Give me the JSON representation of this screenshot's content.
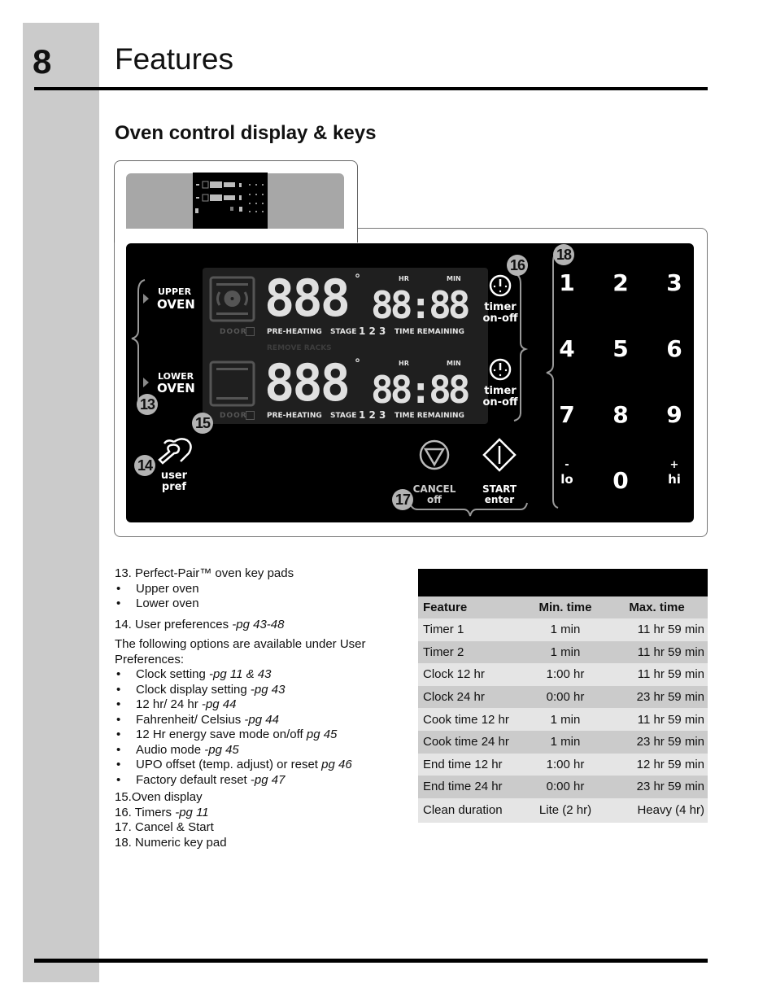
{
  "header": {
    "page_number": "8",
    "title": "Features"
  },
  "section": {
    "title": "Oven control display & keys"
  },
  "diagram": {
    "upper_oven": {
      "small": "UPPER",
      "big": "OVEN"
    },
    "lower_oven": {
      "small": "LOWER",
      "big": "OVEN"
    },
    "lcd": {
      "temp_digits": "888",
      "time_digits": "88:88",
      "hr_label": "HR",
      "min_label": "MIN",
      "door_label": "DOOR",
      "preheating_label": "PRE-HEATING",
      "stage_label": "STAGE",
      "stage_numbers": "1 2 3",
      "time_remaining_label": "TIME REMAINING",
      "remove_racks_label": "REMOVE RACKS",
      "degree_symbol": "°"
    },
    "timer_key": {
      "line1": "timer",
      "line2": "on-off"
    },
    "user_pref_key": {
      "line1": "user",
      "line2": "pref"
    },
    "cancel_key": {
      "line1": "CANCEL",
      "line2": "off"
    },
    "start_key": {
      "line1": "START",
      "line2": "enter"
    },
    "numeric_keys": [
      "1",
      "2",
      "3",
      "4",
      "5",
      "6",
      "7",
      "8",
      "9"
    ],
    "zero_key": "0",
    "lo_key": {
      "symbol": "-",
      "label": "lo"
    },
    "hi_key": {
      "symbol": "+",
      "label": "hi"
    },
    "callouts": [
      "13",
      "14",
      "15",
      "16",
      "17",
      "18"
    ]
  },
  "descriptions": {
    "item13": {
      "num": "13.",
      "text": "Perfect-Pair™ oven key pads"
    },
    "item13_bullets": [
      "Upper oven",
      "Lower oven"
    ],
    "item14": {
      "num": "14.",
      "text": "User preferences ",
      "ref": "-pg 43-48"
    },
    "intro": "The following options are available under User Preferences:",
    "pref_bullets": [
      {
        "text": "Clock setting ",
        "ref": "-pg 11 & 43"
      },
      {
        "text": "Clock display setting ",
        "ref": "-pg 43"
      },
      {
        "text": "12 hr/ 24 hr ",
        "ref": "-pg 44"
      },
      {
        "text": "Fahrenheit/ Celsius ",
        "ref": "-pg 44"
      },
      {
        "text": "12 Hr energy save mode on/off ",
        "ref": "pg 45"
      },
      {
        "text": "Audio mode ",
        "ref": "-pg 45"
      },
      {
        "text": "UPO offset (temp. adjust) or reset ",
        "ref": "pg 46"
      },
      {
        "text": "Factory default reset ",
        "ref": "-pg 47"
      }
    ],
    "items": [
      {
        "num": "15.",
        "text": "Oven display",
        "ref": ""
      },
      {
        "num": "16.",
        "text": "Timers ",
        "ref": "-pg 11"
      },
      {
        "num": "17.",
        "text": "Cancel & Start",
        "ref": ""
      },
      {
        "num": "18.",
        "text": "Numeric key pad",
        "ref": ""
      }
    ]
  },
  "table": {
    "title": "",
    "headers": [
      "Feature",
      "Min. time",
      "Max. time"
    ],
    "rows": [
      [
        "Timer 1",
        "1 min",
        "11 hr 59 min"
      ],
      [
        "Timer 2",
        "1 min",
        "11 hr 59 min"
      ],
      [
        "Clock 12 hr",
        "1:00 hr",
        "11 hr 59 min"
      ],
      [
        "Clock 24 hr",
        "0:00 hr",
        "23 hr 59 min"
      ],
      [
        "Cook time 12 hr",
        "1 min",
        "11 hr 59 min"
      ],
      [
        "Cook time 24 hr",
        "1 min",
        "23 hr 59 min"
      ],
      [
        "End time 12 hr",
        "1:00 hr",
        "12 hr 59 min"
      ],
      [
        "End time 24 hr",
        "0:00 hr",
        "23 hr 59 min"
      ],
      [
        "Clean duration",
        "Lite (2 hr)",
        "Heavy (4 hr)"
      ]
    ]
  }
}
